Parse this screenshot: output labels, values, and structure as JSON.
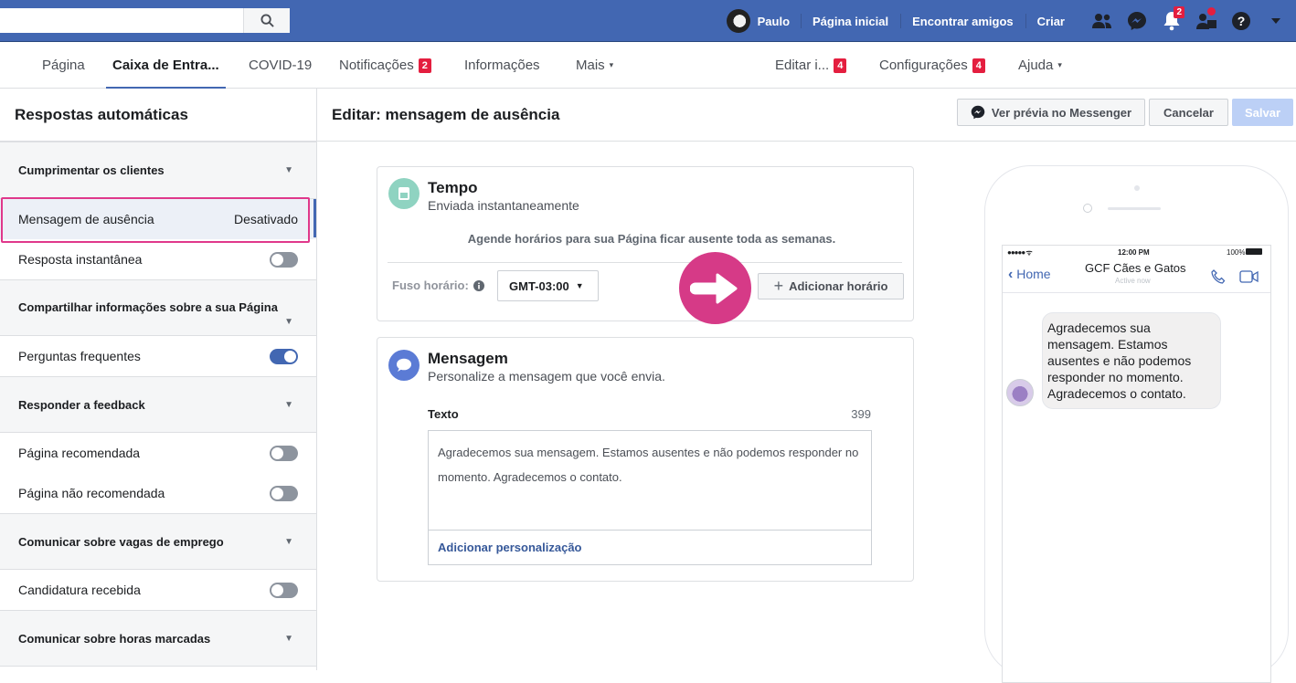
{
  "topbar": {
    "user_name": "Paulo",
    "links": [
      "Página inicial",
      "Encontrar amigos",
      "Criar"
    ],
    "notifications_count": "2"
  },
  "tabs": {
    "items": [
      {
        "label": "Página"
      },
      {
        "label": "Caixa de Entra..."
      },
      {
        "label": "COVID-19"
      },
      {
        "label": "Notificações",
        "badge": "2"
      },
      {
        "label": "Informações"
      },
      {
        "label": "Mais"
      },
      {
        "label": "Editar i...",
        "badge": "4"
      },
      {
        "label": "Configurações",
        "badge": "4"
      },
      {
        "label": "Ajuda"
      }
    ]
  },
  "sidebar": {
    "title": "Respostas automáticas",
    "sections": [
      "Cumprimentar os clientes",
      "Compartilhar informações sobre a sua Página",
      "Responder a feedback",
      "Comunicar sobre vagas de emprego",
      "Comunicar sobre horas marcadas"
    ],
    "rows": [
      {
        "label": "Mensagem de ausência",
        "status": "Desativado"
      },
      {
        "label": "Resposta instantânea",
        "toggle": "off"
      },
      {
        "label": "Perguntas frequentes",
        "toggle": "on"
      },
      {
        "label": "Página recomendada",
        "toggle": "off"
      },
      {
        "label": "Página não recomendada",
        "toggle": "off"
      },
      {
        "label": "Candidatura recebida",
        "toggle": "off"
      }
    ]
  },
  "main": {
    "title": "Editar: mensagem de ausência",
    "preview_label": "Ver prévia no Messenger",
    "cancel_label": "Cancelar",
    "save_label": "Salvar"
  },
  "time_card": {
    "title": "Tempo",
    "subtitle": "Enviada instantaneamente",
    "info": "Agende horários para sua Página ficar ausente toda as semanas.",
    "timezone_label": "Fuso horário:",
    "timezone_value": "GMT-03:00",
    "add_label": "Adicionar horário"
  },
  "message_card": {
    "title": "Mensagem",
    "subtitle": "Personalize a mensagem que você envia.",
    "text_label": "Texto",
    "char_count": "399",
    "text_value": "Agradecemos sua mensagem. Estamos ausentes e não podemos responder no momento. Agradecemos o contato.",
    "personalize_label": "Adicionar personalização"
  },
  "preview": {
    "time": "12:00 PM",
    "battery": "100%",
    "back_label": "Home",
    "page_name": "GCF Cães e Gatos",
    "status": "Active now",
    "bubble_text": "Agradecemos sua mensagem. Estamos ausentes e não podemos responder no momento. Agradecemos o contato."
  },
  "colors": {
    "topbar": "#4267b2",
    "accent": "#4267b2",
    "highlight": "#e0388b",
    "badge": "#e41e3f"
  }
}
